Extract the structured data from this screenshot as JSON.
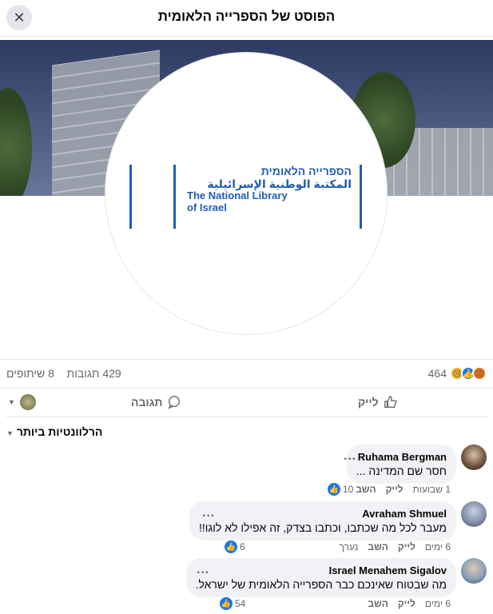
{
  "header": {
    "title": "הפוסט של הספרייה הלאומית",
    "close_glyph": "✕"
  },
  "logo": {
    "hebrew": "הספרייה הלאומית",
    "arabic": "المكتبة الوطنية الإسرائيلية",
    "english_1": "The National Library",
    "english_2": "of Israel"
  },
  "stats": {
    "reactions_count": "464",
    "comments": "429 תגובות",
    "shares": "8 שיתופים"
  },
  "actions": {
    "like": "לייק",
    "comment": "תגובה"
  },
  "sort": {
    "label": "הרלוונטיות ביותר"
  },
  "comments": [
    {
      "name": "Ruhama Bergman",
      "text": "חסר שם המדינה ...",
      "time": "1 שבועות",
      "like": "לייק",
      "reply": "השב",
      "likes": "10",
      "edited": ""
    },
    {
      "name": "Avraham Shmuel",
      "text": "מעבר לכל מה שכתבו, וכתבו בצדק, זה אפילו לא לוגו!!",
      "time": "6 ימים",
      "like": "לייק",
      "reply": "השב",
      "likes": "6",
      "edited": "נערך"
    },
    {
      "name": "Israel Menahem Sigalov",
      "text": "מה שבטוח שאינכם כבר הספרייה הלאומית של ישראל.",
      "time": "6 ימים",
      "like": "לייק",
      "reply": "השב",
      "likes": "54",
      "edited": ""
    }
  ],
  "colors": {
    "brand_blue": "#1f5db7",
    "fb_blue": "#1877f2"
  }
}
